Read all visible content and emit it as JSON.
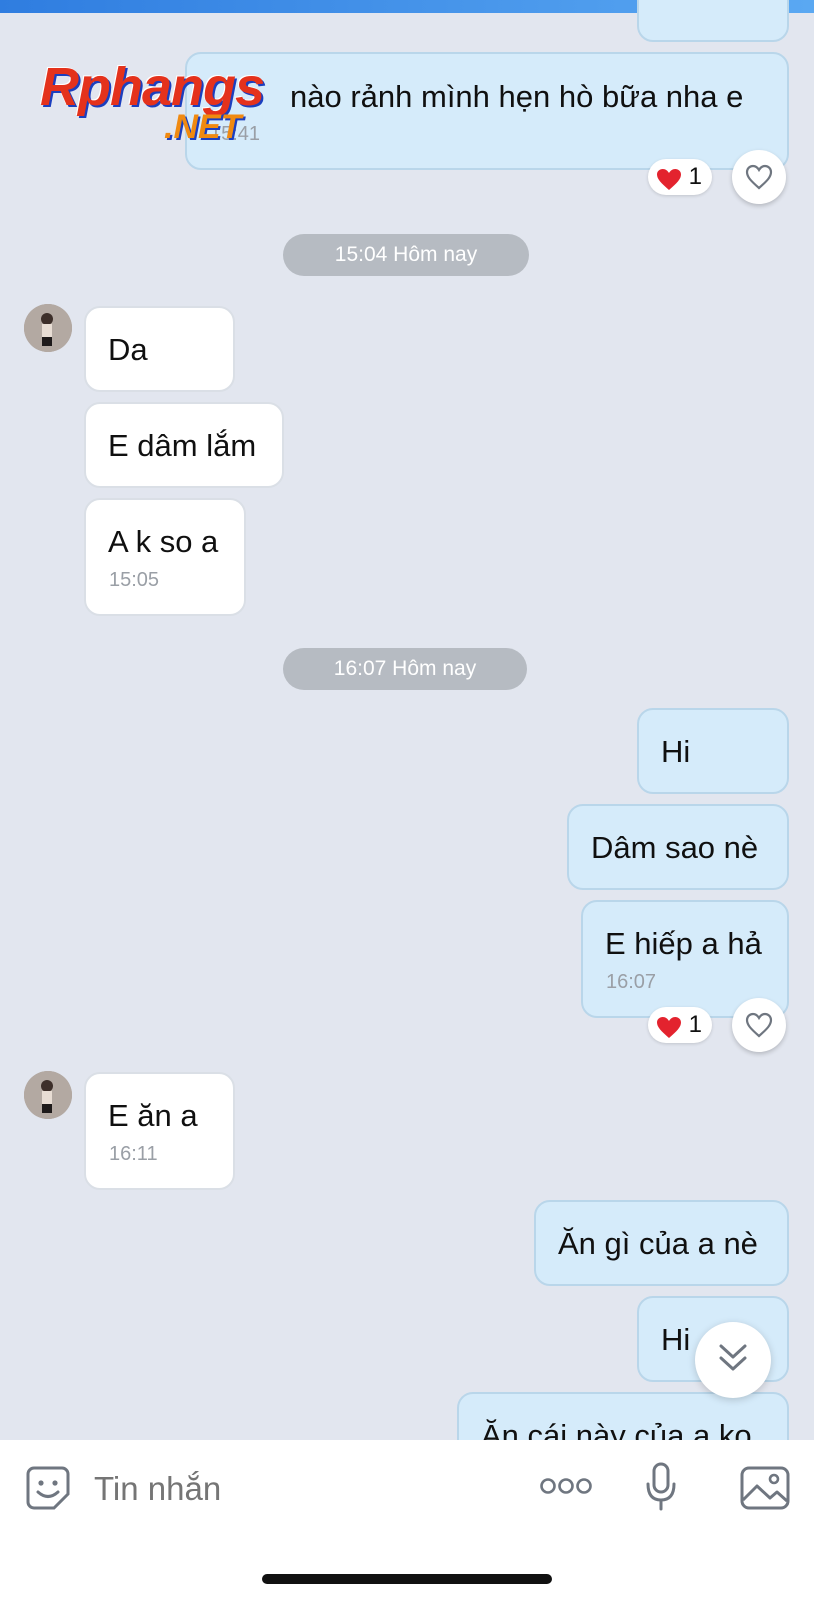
{
  "messages": {
    "m0_text": "nào rảnh mình hẹn hò bữa nha e",
    "m0_time": "15:41",
    "m0_reaction_count": "1",
    "stamp1": "15:04 Hôm nay",
    "m1_text": "Da",
    "m2_text": "E dâm lắm",
    "m3_text": "A k so a",
    "m3_time": "15:05",
    "stamp2": "16:07 Hôm nay",
    "m4_text": "Hi",
    "m5_text": "Dâm sao nè",
    "m6_text": "E hiếp a hả",
    "m6_time": "16:07",
    "m6_reaction_count": "1",
    "m7_text": "E ăn a",
    "m7_time": "16:11",
    "m8_text": "Ăn gì của a nè",
    "m9_text": "Hi",
    "m10_text": "Ăn cái này của a ko"
  },
  "watermark": {
    "main": "Rphangs",
    "sub": ".NET"
  },
  "input": {
    "placeholder": "Tin nhắn"
  },
  "icons": {
    "sticker": "emoji-sticker-icon",
    "more": "more-dots-icon",
    "mic": "microphone-icon",
    "image": "image-gallery-icon",
    "like": "heart-outline-icon",
    "reaction": "red-heart-icon",
    "scroll": "double-chevron-down-icon"
  },
  "colors": {
    "background": "#e2e6ef",
    "outgoing_bubble": "#d5ebfa",
    "incoming_bubble": "#ffffff",
    "time_stamp_pill": "#b6bbc2",
    "accent": "#2f7de0"
  }
}
